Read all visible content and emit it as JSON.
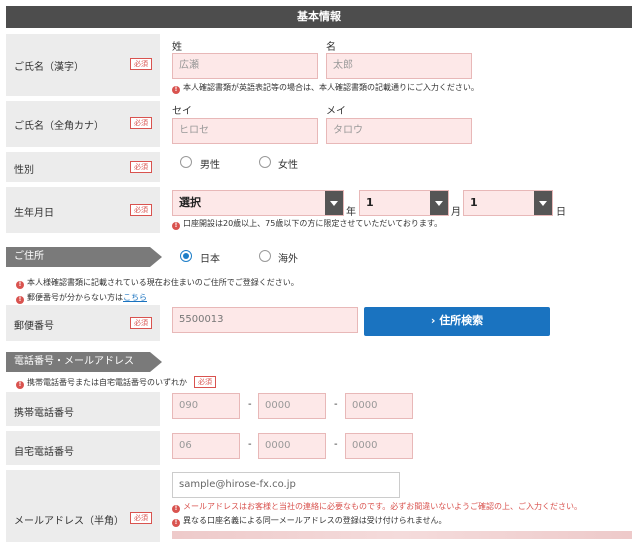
{
  "header": {
    "title": "基本情報"
  },
  "required": "必須",
  "name_kanji": {
    "label": "ご氏名（漢字）",
    "sei_label": "姓",
    "mei_label": "名",
    "sei_placeholder": "広瀬",
    "mei_placeholder": "太郎",
    "note": "本人確認書類が英語表記等の場合は、本人確認書類の記載通りにご入力ください。"
  },
  "name_kana": {
    "label": "ご氏名（全角カナ）",
    "sei_label": "セイ",
    "mei_label": "メイ",
    "sei_placeholder": "ヒロセ",
    "mei_placeholder": "タロウ"
  },
  "gender": {
    "label": "性別",
    "options": [
      "男性",
      "女性"
    ]
  },
  "birth": {
    "label": "生年月日",
    "year_value": "選択",
    "year_unit": "年",
    "month_value": "1",
    "month_unit": "月",
    "day_value": "1",
    "day_unit": "日",
    "note": "口座開設は20歳以上、75歳以下の方に限定させていただいております。"
  },
  "address": {
    "section": "ご住所",
    "options": [
      "日本",
      "海外"
    ],
    "note1": "本人様確認書類に記載されている現在お住まいのご住所でご登録ください。",
    "note2_prefix": "郵便番号が分からない方は",
    "note2_link": "こちら",
    "postal_label": "郵便番号",
    "postal_value": "5500013",
    "search_button": "住所検索"
  },
  "contact": {
    "section": "電話番号・メールアドレス",
    "note": "携帯電話番号または自宅電話番号のいずれか",
    "mobile_label": "携帯電話番号",
    "mobile": [
      "090",
      "0000",
      "0000"
    ],
    "home_label": "自宅電話番号",
    "home": [
      "06",
      "0000",
      "0000"
    ],
    "dash": "-",
    "email_label": "メールアドレス（半角）",
    "email_placeholder": "sample@hirose-fx.co.jp",
    "email_note1": "メールアドレスはお客様と当社の連絡に必要なものです。必ずお間違いないようご確認の上、ご入力ください。",
    "email_note2": "異なる口座名義による同一メールアドレスの登録は受け付けられません。"
  },
  "colors": {
    "accent": "#1a73c0",
    "error": "#d9534f",
    "input_bg": "#fde8e8"
  }
}
